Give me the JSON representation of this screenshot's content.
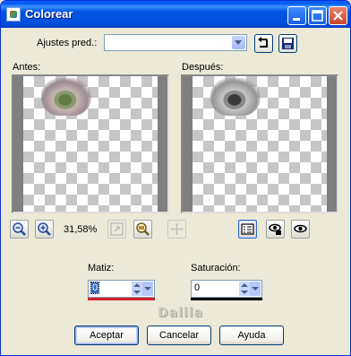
{
  "window": {
    "title": "Colorear"
  },
  "presets": {
    "label": "Ajustes pred.:",
    "value": ""
  },
  "before": {
    "label": "Antes:"
  },
  "after": {
    "label": "Después:"
  },
  "zoom": {
    "level": "31,58%"
  },
  "hue": {
    "label": "Matiz:",
    "value": "0",
    "bar_color": "#d4202a"
  },
  "saturation": {
    "label": "Saturación:",
    "value": "0",
    "bar_color": "#000000"
  },
  "watermark": "Dalila",
  "buttons": {
    "ok": "Aceptar",
    "cancel": "Cancelar",
    "help": "Ayuda"
  },
  "icons": [
    "app-icon",
    "minimize-icon",
    "maximize-icon",
    "close-icon",
    "reset-icon",
    "save-icon",
    "zoom-out-icon",
    "zoom-in-icon",
    "fit-window-icon",
    "navigate-icon",
    "pan-icon",
    "proof-icon",
    "lock-preview-icon",
    "auto-proof-icon"
  ],
  "colors": {
    "titlebar": "#0054e3",
    "face": "#ece9d8",
    "border": "#0831d9"
  }
}
